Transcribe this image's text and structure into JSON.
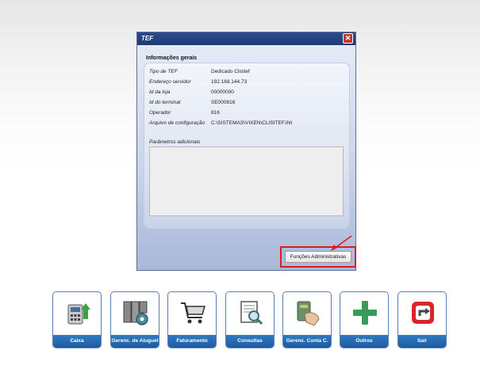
{
  "dialog": {
    "title": "TEF",
    "close_icon": "close-icon",
    "section_title": "Informações gerais",
    "info": [
      {
        "label": "Tipo de TEF",
        "value": "Dedicado Clisitef"
      },
      {
        "label": "Endereço servidor",
        "value": "192.168.144.73"
      },
      {
        "label": "Id da loja",
        "value": "00000000"
      },
      {
        "label": "Id do terminal",
        "value": "SE000816"
      },
      {
        "label": "Operador",
        "value": "816"
      },
      {
        "label": "Arquivo de configuração",
        "value": "C:\\SISTEMAS\\VIXEN\\CLISITEF.INI"
      }
    ],
    "extra_label": "Parâmetros adicionais",
    "extra_value": "",
    "admin_button": "Funções Administrativas"
  },
  "toolbar": [
    {
      "label": "Caixa",
      "icon": "cash-register-icon"
    },
    {
      "label": "Gerenc. de Aluguel",
      "icon": "rental-management-icon"
    },
    {
      "label": "Faturamento",
      "icon": "shopping-cart-icon"
    },
    {
      "label": "Consultas",
      "icon": "search-document-icon"
    },
    {
      "label": "Gerenc. Conta C.",
      "icon": "card-hand-icon"
    },
    {
      "label": "Outros",
      "icon": "plus-icon"
    },
    {
      "label": "Sair",
      "icon": "exit-icon"
    }
  ],
  "colors": {
    "toolbar_label_bg": "#1e5aa0",
    "highlight_red": "#e01b1b",
    "title_bar": "#1e3a78"
  }
}
